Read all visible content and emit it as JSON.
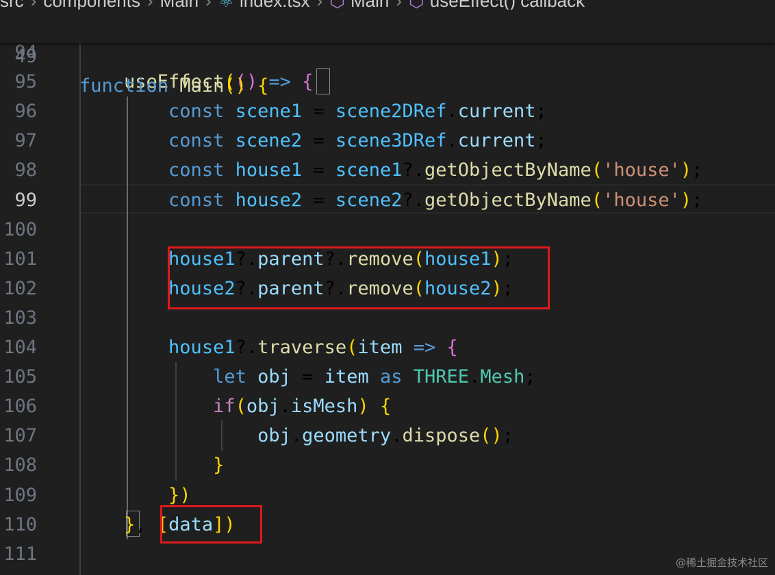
{
  "breadcrumb": {
    "items": [
      {
        "label": "src",
        "icon": null
      },
      {
        "label": "components",
        "icon": null
      },
      {
        "label": "Main",
        "icon": null
      },
      {
        "label": "index.tsx",
        "icon": "react-icon"
      },
      {
        "label": "Main",
        "icon": "symbol-method-icon"
      },
      {
        "label": "useEffect() callback",
        "icon": "symbol-method-icon"
      }
    ]
  },
  "sticky_line": {
    "number": "49",
    "text": "function Main() {"
  },
  "lines": [
    {
      "number": "94",
      "text": ""
    },
    {
      "number": "95",
      "text": "    useEffect(() => {"
    },
    {
      "number": "96",
      "text": "        const scene1 = scene2DRef.current;"
    },
    {
      "number": "97",
      "text": "        const scene2 = scene3DRef.current;"
    },
    {
      "number": "98",
      "text": "        const house1 = scene1?.getObjectByName('house');"
    },
    {
      "number": "99",
      "text": "        const house2 = scene2?.getObjectByName('house');",
      "active": true
    },
    {
      "number": "100",
      "text": ""
    },
    {
      "number": "101",
      "text": "        house1?.parent?.remove(house1);"
    },
    {
      "number": "102",
      "text": "        house2?.parent?.remove(house2);"
    },
    {
      "number": "103",
      "text": ""
    },
    {
      "number": "104",
      "text": "        house1?.traverse(item => {"
    },
    {
      "number": "105",
      "text": "            let obj = item as THREE.Mesh;"
    },
    {
      "number": "106",
      "text": "            if(obj.isMesh) {"
    },
    {
      "number": "107",
      "text": "                obj.geometry.dispose();"
    },
    {
      "number": "108",
      "text": "            }"
    },
    {
      "number": "109",
      "text": "        })"
    },
    {
      "number": "110",
      "text": "    }, [data])"
    },
    {
      "number": "111",
      "text": ""
    }
  ],
  "watermark": "@稀土掘金技术社区",
  "colors": {
    "background": "#1f1f1f",
    "keyword": "#569cd6",
    "function": "#dcdcaa",
    "variable": "#9cdcfe",
    "constant": "#4fc1ff",
    "string": "#ce9178",
    "highlight_box": "#e0191b"
  }
}
